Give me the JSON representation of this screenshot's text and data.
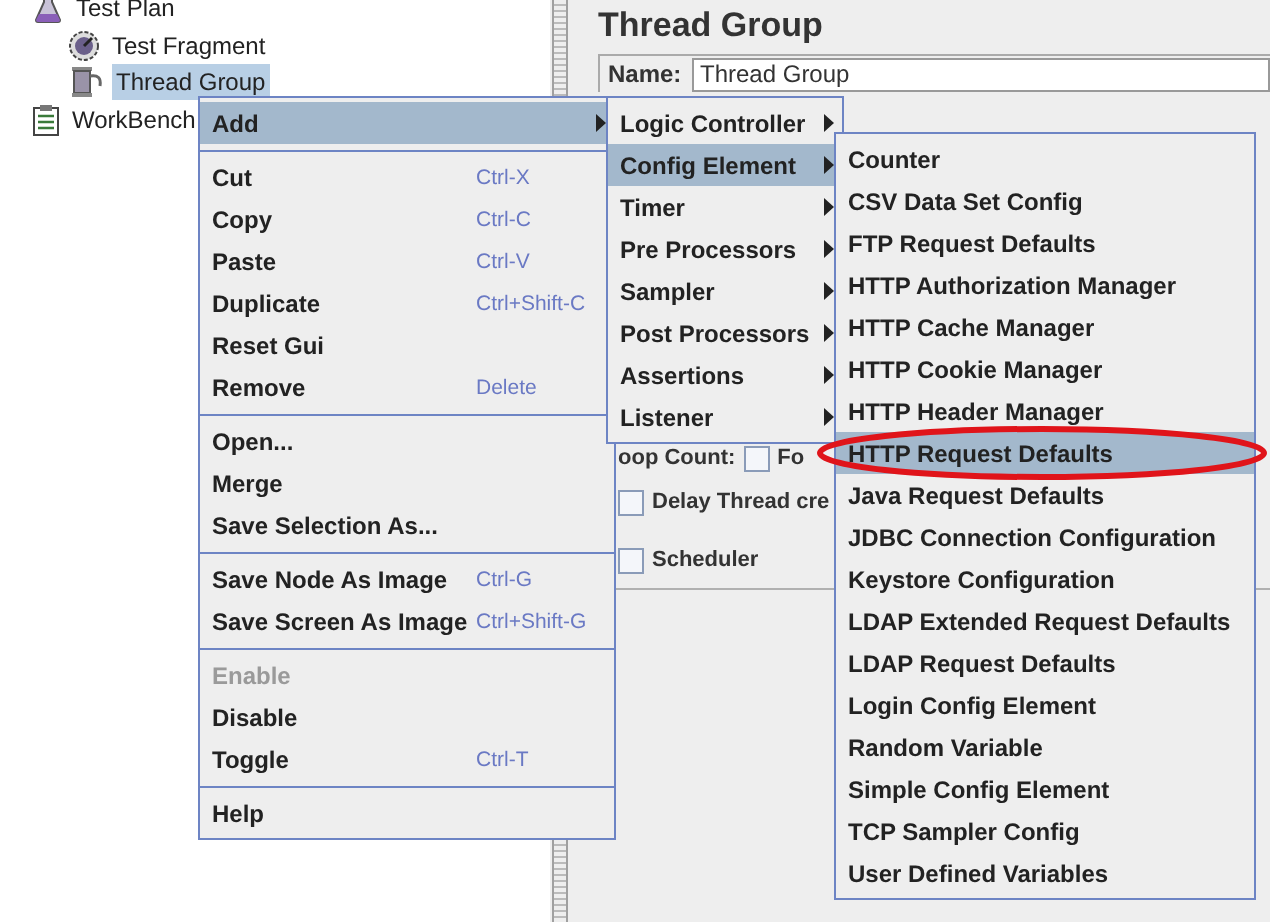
{
  "tree": [
    {
      "label": "Test Plan",
      "kind": "flask",
      "selected": false,
      "children": [
        {
          "label": "Test Fragment",
          "kind": "fragment",
          "selected": false
        },
        {
          "label": "Thread Group",
          "kind": "spool",
          "selected": true
        }
      ]
    },
    {
      "label": "WorkBench",
      "kind": "clipboard",
      "selected": false
    }
  ],
  "panel": {
    "title": "Thread Group",
    "name_label": "Name:",
    "name_value": "Thread Group",
    "loop_count_label": "oop Count:",
    "forever": {
      "label": "Fo",
      "checked": false
    },
    "delay": {
      "label": "Delay Thread cre",
      "checked": false
    },
    "scheduler": {
      "label": "Scheduler",
      "checked": false
    }
  },
  "context_menu": [
    {
      "kind": "submenu",
      "label": "Add",
      "selected": true,
      "disabled": false
    },
    {
      "kind": "separator"
    },
    {
      "kind": "item",
      "label": "Cut",
      "shortcut": "Ctrl-X",
      "selected": false,
      "disabled": false
    },
    {
      "kind": "item",
      "label": "Copy",
      "shortcut": "Ctrl-C",
      "selected": false,
      "disabled": false
    },
    {
      "kind": "item",
      "label": "Paste",
      "shortcut": "Ctrl-V",
      "selected": false,
      "disabled": false
    },
    {
      "kind": "item",
      "label": "Duplicate",
      "shortcut": "Ctrl+Shift-C",
      "selected": false,
      "disabled": false
    },
    {
      "kind": "item",
      "label": "Reset Gui",
      "selected": false,
      "disabled": false
    },
    {
      "kind": "item",
      "label": "Remove",
      "shortcut": "Delete",
      "selected": false,
      "disabled": false
    },
    {
      "kind": "separator"
    },
    {
      "kind": "item",
      "label": "Open...",
      "selected": false,
      "disabled": false
    },
    {
      "kind": "item",
      "label": "Merge",
      "selected": false,
      "disabled": false
    },
    {
      "kind": "item",
      "label": "Save Selection As...",
      "selected": false,
      "disabled": false
    },
    {
      "kind": "separator"
    },
    {
      "kind": "item",
      "label": "Save Node As Image",
      "shortcut": "Ctrl-G",
      "selected": false,
      "disabled": false
    },
    {
      "kind": "item",
      "label": "Save Screen As Image",
      "shortcut": "Ctrl+Shift-G",
      "selected": false,
      "disabled": false
    },
    {
      "kind": "separator"
    },
    {
      "kind": "item",
      "label": "Enable",
      "selected": false,
      "disabled": true
    },
    {
      "kind": "item",
      "label": "Disable",
      "selected": false,
      "disabled": false
    },
    {
      "kind": "item",
      "label": "Toggle",
      "shortcut": "Ctrl-T",
      "selected": false,
      "disabled": false
    },
    {
      "kind": "separator"
    },
    {
      "kind": "item",
      "label": "Help",
      "selected": false,
      "disabled": false
    }
  ],
  "add_menu": [
    {
      "label": "Logic Controller",
      "selected": false
    },
    {
      "label": "Config Element",
      "selected": true
    },
    {
      "label": "Timer",
      "selected": false
    },
    {
      "label": "Pre Processors",
      "selected": false
    },
    {
      "label": "Sampler",
      "selected": false
    },
    {
      "label": "Post Processors",
      "selected": false
    },
    {
      "label": "Assertions",
      "selected": false
    },
    {
      "label": "Listener",
      "selected": false
    }
  ],
  "config_menu": [
    {
      "label": "Counter",
      "selected": false,
      "circled": false
    },
    {
      "label": "CSV Data Set Config",
      "selected": false,
      "circled": false
    },
    {
      "label": "FTP Request Defaults",
      "selected": false,
      "circled": false
    },
    {
      "label": "HTTP Authorization Manager",
      "selected": false,
      "circled": false
    },
    {
      "label": "HTTP Cache Manager",
      "selected": false,
      "circled": false
    },
    {
      "label": "HTTP Cookie Manager",
      "selected": false,
      "circled": false
    },
    {
      "label": "HTTP Header Manager",
      "selected": false,
      "circled": false
    },
    {
      "label": "HTTP Request Defaults",
      "selected": true,
      "circled": true
    },
    {
      "label": "Java Request Defaults",
      "selected": false,
      "circled": false
    },
    {
      "label": "JDBC Connection Configuration",
      "selected": false,
      "circled": false
    },
    {
      "label": "Keystore Configuration",
      "selected": false,
      "circled": false
    },
    {
      "label": "LDAP Extended Request Defaults",
      "selected": false,
      "circled": false
    },
    {
      "label": "LDAP Request Defaults",
      "selected": false,
      "circled": false
    },
    {
      "label": "Login Config Element",
      "selected": false,
      "circled": false
    },
    {
      "label": "Random Variable",
      "selected": false,
      "circled": false
    },
    {
      "label": "Simple Config Element",
      "selected": false,
      "circled": false
    },
    {
      "label": "TCP Sampler Config",
      "selected": false,
      "circled": false
    },
    {
      "label": "User Defined Variables",
      "selected": false,
      "circled": false
    }
  ]
}
